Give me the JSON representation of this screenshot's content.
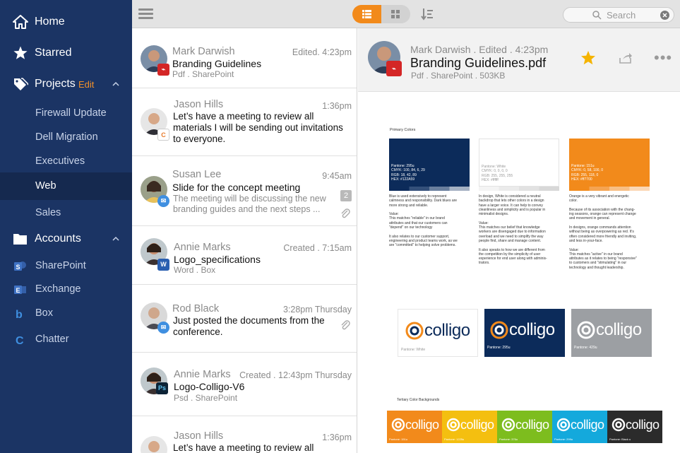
{
  "sidebar": {
    "home": "Home",
    "starred": "Starred",
    "projects": "Projects",
    "projects_edit": "Edit",
    "project_items": [
      "Firewall Update",
      "Dell Migration",
      "Executives",
      "Web",
      "Sales"
    ],
    "accounts": "Accounts",
    "account_items": [
      "SharePoint",
      "Exchange",
      "Box",
      "Chatter"
    ]
  },
  "toolbar": {
    "search_placeholder": "Search"
  },
  "messages": [
    {
      "sender": "Mark Darwish",
      "time": "Edited. 4:23pm",
      "subject": "Branding Guidelines",
      "meta": "Pdf . SharePoint"
    },
    {
      "sender": "Jason Hills",
      "time": "1:36pm",
      "body": "Let’s have a meeting to review all materials I will be sending out invitations to everyone."
    },
    {
      "sender": "Susan Lee",
      "time": "9:45am",
      "subject": "Slide for the concept meeting",
      "preview": "The meeting will be discussing the new branding guides and the next steps ...",
      "count": "2"
    },
    {
      "sender": "Annie Marks",
      "time": "Created . 7:15am",
      "subject": "Logo_specifications",
      "meta": "Word . Box"
    },
    {
      "sender": "Rod Black",
      "time": "3:28pm Thursday",
      "body": "Just posted the documents from the conference."
    },
    {
      "sender": "Annie Marks",
      "time": "Created . 12:43pm Thursday",
      "subject": "Logo-Colligo-V6",
      "meta": "Psd . SharePoint"
    },
    {
      "sender": "Jason Hills",
      "time": "1:36pm",
      "body": "Let’s have a meeting to review all"
    }
  ],
  "detail": {
    "sender": "Mark Darwish . Edited . 4:23pm",
    "title": "Branding Guidelines.pdf",
    "meta": "Pdf . SharePoint . 503KB"
  },
  "document": {
    "primary_heading": "Primary Colors",
    "swatches": [
      {
        "color": "#0c2b5a",
        "specs": [
          "Pantone: 295u",
          "CMYK:      100, 84, 6, 29",
          "RGB:         18, 42, 89",
          "HEX:         #122A59"
        ]
      },
      {
        "color": "#ffffff",
        "specs": [
          "Pantone:  White",
          "CMYK:      0, 0, 0, 0",
          "RGB:         255, 255, 255",
          "HEX:         #ffffff"
        ]
      },
      {
        "color": "#f28a1b",
        "specs": [
          "Pantone: 151u",
          "CMYK:      0, 58, 100, 0",
          "RGB:         255, 118, 0",
          "HEX:         #ff7700"
        ]
      }
    ],
    "blue_text": [
      "Blue is used extensively to represent",
      "calmness and responsibility. Dark blues are",
      "more strong and reliable.",
      "",
      "Value:",
      "This matches \"reliable\" in our brand",
      "attributes and that our customers can",
      "\"depend\" on our technology",
      "",
      "It also relates to our customer support,",
      "engineering and product teams work, as we",
      "are \"committed\" to helping solve problems."
    ],
    "white_text": [
      "In design, White is considered a neutral",
      "backdrop that lets other colors in a design",
      "have a larger voice. It can help to convey",
      "cleanliness and simplicity and is popular in",
      "minimalist designs.",
      "",
      "Value:",
      "This matches our belief that knowledge",
      "workers are disengaged due to information",
      "overload and we need to simplify the way",
      "people find, share and manage content.",
      "",
      "It also speaks to how we are different from",
      "the competition by the simplicity of user",
      "experience for end user along with adminis-",
      "trators."
    ],
    "orange_text": [
      "Orange is a very vibrant and energetic",
      "color.",
      "",
      "Because of its association with the chang-",
      "ing seasons, orange can represent change",
      "and movement in general.",
      "",
      "In designs, orange commands attention",
      "without being as overpowering as red. It's",
      "often considered more friendly and inviting,",
      "and less in-your-face.",
      "",
      "Value:",
      "This matches \"active\" in our brand",
      "attributes as it relates to being \"responsive\"",
      "to customers and \"stimulating\" in our",
      "technology and thought leadership."
    ],
    "logo_word": "colligo",
    "logo_cards": [
      {
        "bg": "#ffffff",
        "caption": "Pantone: White"
      },
      {
        "bg": "#0c2b5a",
        "caption": "Pantone: 295u"
      },
      {
        "bg": "#9c9fa3",
        "caption": "Pantone: 429u"
      }
    ],
    "tertiary_heading": "Tertiary Color Backgrounds",
    "tertiary": [
      {
        "color": "#f28a1b",
        "caption": "Pantone: 151u"
      },
      {
        "color": "#f4bf10",
        "caption": "Pantone: 1225u"
      },
      {
        "color": "#7dbd1e",
        "caption": "Pantone: 376u"
      },
      {
        "color": "#14a9dc",
        "caption": "Pantone: 299u"
      },
      {
        "color": "#2b2b2b",
        "caption": "Pantone: Black u"
      }
    ]
  }
}
